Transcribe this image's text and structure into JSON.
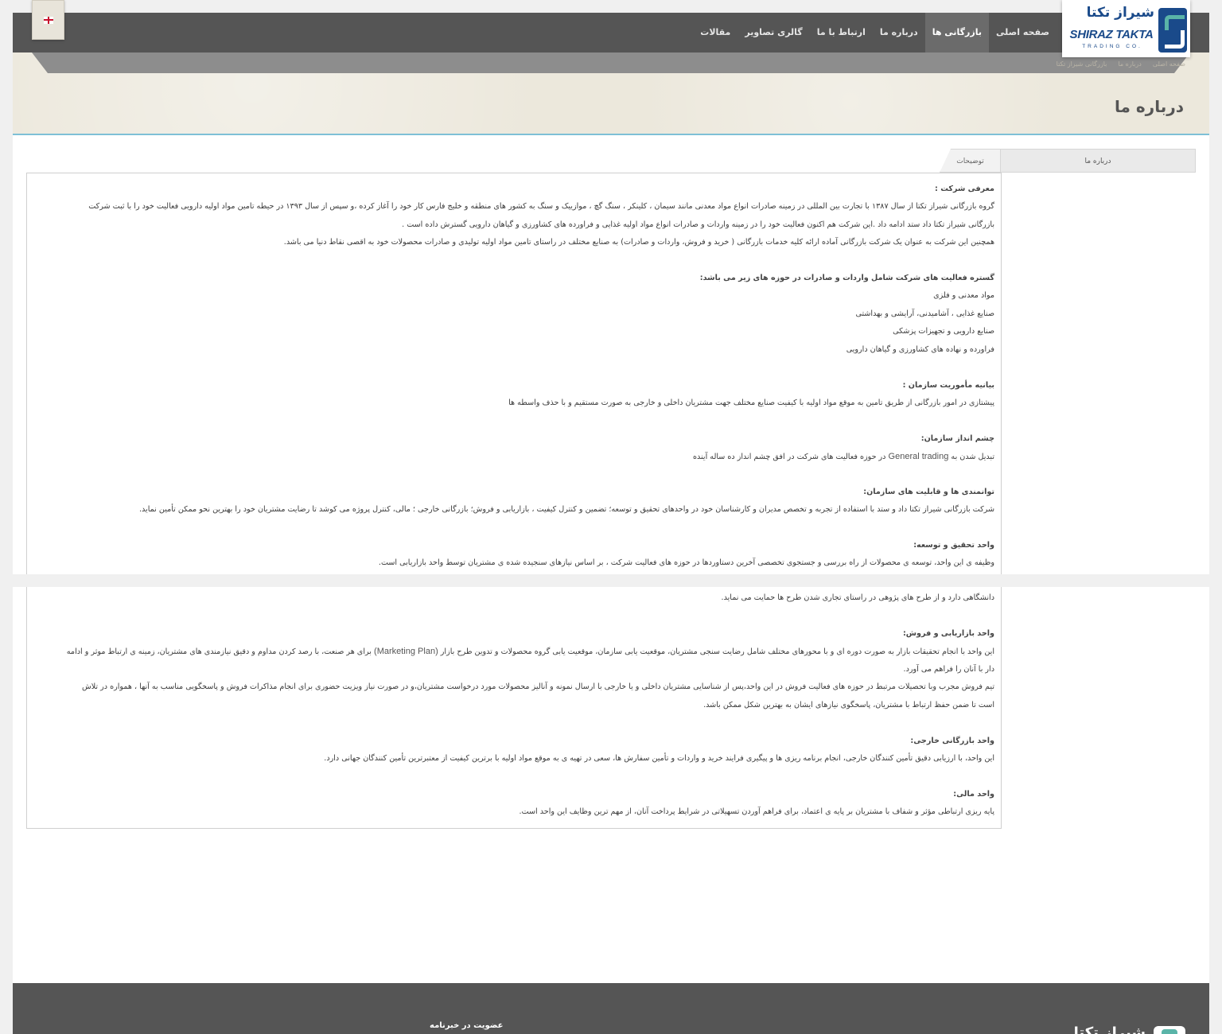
{
  "header": {
    "logo": {
      "persian": "شیراز تکتا",
      "english": "SHIRAZ TAKTA",
      "tagline": "TRADING CO."
    },
    "nav": [
      {
        "label": "صفحه اصلی",
        "active": false
      },
      {
        "label": "بازرگانی ها",
        "active": true
      },
      {
        "label": "درباره ما",
        "active": false
      },
      {
        "label": "ارتباط با ما",
        "active": false
      },
      {
        "label": "گالری تصاویر",
        "active": false
      },
      {
        "label": "مقالات",
        "active": false
      }
    ],
    "language_flag": "english-flag-icon"
  },
  "banner": {
    "breadcrumb": [
      "صفحه اصلی",
      "درباره ما",
      "بازرگانی شیراز تکتا"
    ],
    "title": "درباره ما"
  },
  "tabs": [
    {
      "label": "درباره ما"
    },
    {
      "label": "توضیحات"
    }
  ],
  "content": {
    "intro_heading": "معرفی شرکت :",
    "intro_p1_line1": "گروه بازرگانی شیراز تکتا از سال ۱۳۸۷ با تجارت بین المللی در زمینه صادرات انواع مواد معدنی مانند سیمان ، کلینکر ، سنگ گچ ، موازییک و سنگ به کشور های منطقه و خلیج فارس کار خود را آغاز کرده ،و سپس از سال ۱۳۹۳ در حیطه تامین مواد اولیه دارویی فعالیت خود را با ثبت شرکت",
    "intro_p1_line2": "بازرگانی شیراز تکتا داد ستد ادامه داد .این شرکت هم اکنون فعالیت خود را در زمینه واردات و صادرات انواع مواد اولیه غذایی و فراورده های کشاورزی و گیاهان دارویی گسترش داده است .",
    "intro_p2": "همچنین این شرکت به عنوان یک شرکت بازرگانی آماده ارائه کلیه خدمات بازرگانی ( خرید و فروش، واردات و صادرات) به صنایع مختلف در راستای تامین مواد اولیه تولیدی و صادرات محصولات خود به اقصی نقاط دنیا می باشد.",
    "scope_heading": "گستره فعالیت های شرکت شامل واردات و صادرات در حوزه های زیر می باشد:",
    "scope_items": [
      " مواد معدنی و فلزی",
      " صنایع غذایی ، آشامیدنی، آرایشی و بهداشتی",
      " صنایع دارویی و تجهیزات پزشکی",
      "فراورده و نهاده های کشاورزی و گیاهان دارویی"
    ],
    "scope_item_marker": "",
    "mission_heading": "بیانیه مأموریت سازمان :",
    "mission_text": "پیشتازی در امور بازرگانی از طریق تامین به موقع مواد اولیه با کیفیت صنایع مختلف جهت مشتریان داخلی و خارجی به صورت مستقیم و با حذف واسطه ها",
    "vision_heading": "چشم انداز سازمان:",
    "vision_pre": "تبدیل شدن به",
    "vision_en": "General trading",
    "vision_post": "در حوزه فعالیت های شرکت در افق چشم انداز ده ساله آینده",
    "capability_heading": "توانمندی ها و قابلیت های سازمان:",
    "capability_text": "شرکت بازرگانی شیراز تکتا داد و ستد با استفاده از تجربه و تخصص مدیران و کارشناسان خود در واحدهای تحقیق و توسعه؛ تضمین و کنترل کیفیت ، بازاریابی و فروش؛ بازرگانی خارجی ؛ مالی، کنترل پروژه می کوشد تا رضایت مشتریان خود را بهترین نحو ممکن تأمین نماید.",
    "rnd_heading": "واحد تحقیق و توسعه:",
    "rnd_line1": "وظیفه ی این واحد، توسعه ی محصولات از راه بررسی و جستجوی تخصصی آخرین دستاوردها در حوزه های فعالیت شرکت ، بر اساس نیازهای سنجیده شده ی مشتریان توسط واحد بازاریابی است.",
    "rnd_line2": "دانشگاهی دارد و از طرح های پژوهی در راستای تجاری شدن طرح ها حمایت می نماید.",
    "marketing_heading": "واحد بازاریابی و فروش:",
    "marketing_line1_pre": "این واحد با انجام تحقیقات بازار به صورت دوره ای و با محورهای مختلف شامل رضایت سنجی مشتریان، موقعیت یابی سازمان، موقعیت یابی گروه محصولات و تدوین طرح بازار",
    "marketing_line1_en": "(Marketing Plan)",
    "marketing_line1_post": "برای هر صنعت، با رصد کردن مداوم و دقیق نیازمندی های مشتریان، زمینه ی ارتباط موثر و ادامه",
    "marketing_line2": "دار با آنان را فراهم می آورد.",
    "sales_line1": "تیم فروش مجرب وبا تحصیلات مرتبط در حوزه های فعالیت فروش در این واحد،پس از شناسایی مشتریان داخلی و یا خارجی با ارسال نمونه و آنالیز محصولات مورد درخواست مشتریان،و در صورت نیاز ویزیت حضوری برای انجام مذاکرات فروش و پاسخگویی مناسب به آنها ، همواره در تلاش",
    "sales_line2": "است تا ضمن حفظ ارتباط با مشتریان، پاسخگوی نیازهای ایشان به بهترین شکل ممکن باشد.",
    "foreign_heading": "واحد بازرگانی خارجی:",
    "foreign_text": "این واحد، با ارزیابی دقیق تأمین کنندگان خارجی، انجام برنامه ریزی ها و پیگیری فرایند خرید و واردات و تأمین سفارش ها، سعی در تهیه ی به موقع مواد اولیه با برترین کیفیت از معتبرترین تأمین کنندگان جهانی دارد.",
    "finance_heading": "واحد مالی:",
    "finance_text": "پایه ریزی ارتباطی مؤثر و شفاف با مشتریان بر پایه ی اعتماد، برای فراهم آوردن تسهیلاتی در شرایط پرداخت آنان، از مهم ترین وظایف این واحد است."
  },
  "footer": {
    "newsletter": "عضویت در خبرنامه",
    "logo": "شیراز تکتا"
  }
}
